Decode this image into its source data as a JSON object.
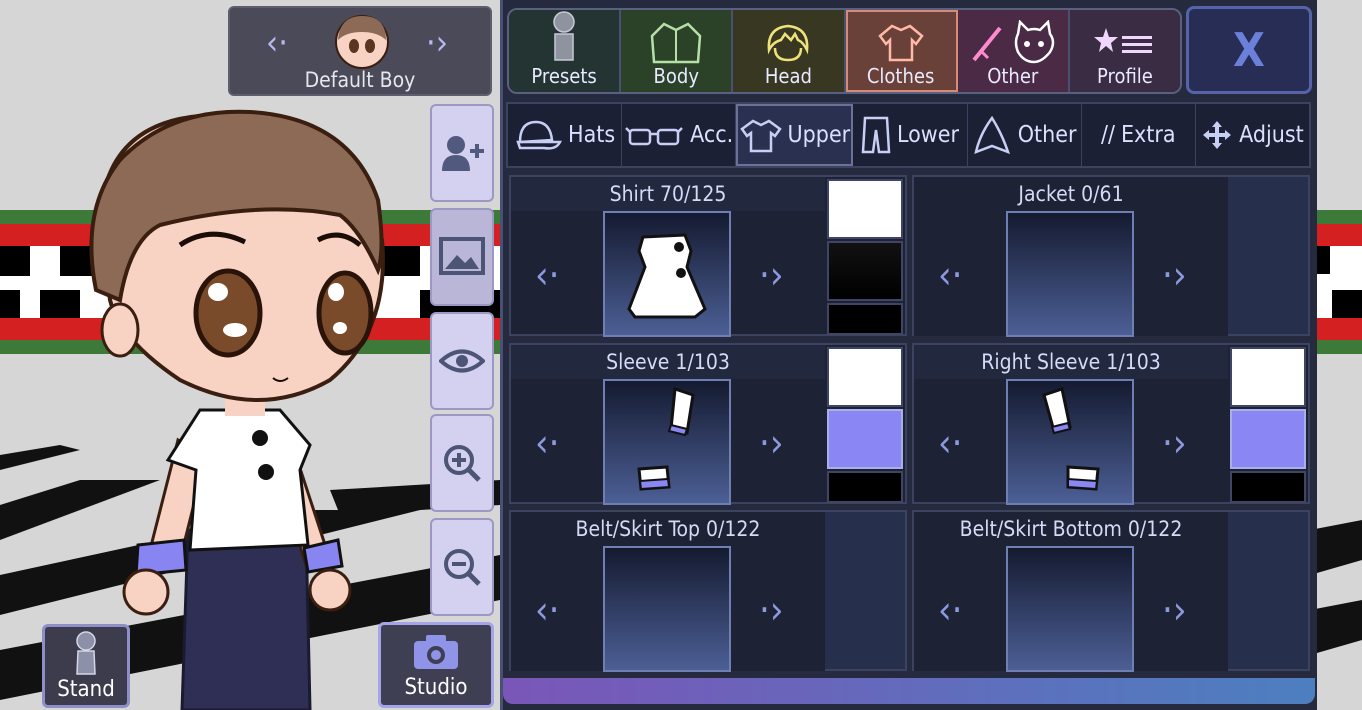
{
  "character": {
    "name": "Default Boy"
  },
  "side_buttons": [
    "add-character",
    "background",
    "visibility",
    "zoom-in",
    "zoom-out"
  ],
  "bottom_buttons": {
    "stand": "Stand",
    "studio": "Studio"
  },
  "tabs": [
    {
      "label": "Presets",
      "icon": "person-icon",
      "color": "#2a3e3b"
    },
    {
      "label": "Body",
      "icon": "jacket-icon",
      "color": "#304b2a"
    },
    {
      "label": "Head",
      "icon": "hair-icon",
      "color": "#3b3b27"
    },
    {
      "label": "Clothes",
      "icon": "shirt-icon",
      "color": "#63403a",
      "active": true
    },
    {
      "label": "Other",
      "icon": "sword-cat-icon",
      "color": "#4e2d47"
    },
    {
      "label": "Profile",
      "icon": "star-list-icon",
      "color": "#3c2d44"
    }
  ],
  "close_label": "X",
  "subtabs": [
    {
      "label": "Hats",
      "icon": "cap-icon"
    },
    {
      "label": "Acc.",
      "icon": "glasses-icon"
    },
    {
      "label": "Upper",
      "icon": "tshirt-icon",
      "active": true
    },
    {
      "label": "Lower",
      "icon": "pants-icon"
    },
    {
      "label": "Other",
      "icon": "cloak-icon"
    },
    {
      "label": "Extra",
      "icon": "slashes-icon",
      "prefix": "//"
    },
    {
      "label": "Adjust",
      "icon": "move-icon"
    }
  ],
  "items": [
    {
      "title": "Shirt 70/125",
      "swatches": [
        "#ffffff",
        "#000000",
        "#000000"
      ]
    },
    {
      "title": "Jacket 0/61",
      "swatches": []
    },
    {
      "title": "Sleeve 1/103",
      "swatches": [
        "#ffffff",
        "#8a87f5",
        "#000000"
      ]
    },
    {
      "title": "Right Sleeve 1/103",
      "swatches": [
        "#ffffff",
        "#8a87f5",
        "#000000"
      ]
    },
    {
      "title": "Belt/Skirt Top 0/122",
      "swatches": []
    },
    {
      "title": "Belt/Skirt Bottom 0/122",
      "swatches": []
    }
  ]
}
